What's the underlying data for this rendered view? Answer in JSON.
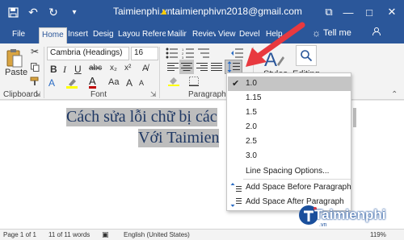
{
  "titlebar": {
    "doc_title": "Taimienphi.vn...",
    "account": "taimienphivn2018@gmail.com",
    "restore_glyph": "⧉",
    "minimize_glyph": "—",
    "maximize_glyph": "□",
    "close_glyph": "✕"
  },
  "tabs": [
    "File",
    "Home",
    "Insert",
    "Desig",
    "Layou",
    "Refere",
    "Mailir",
    "Reviev",
    "View",
    "Devel",
    "Help"
  ],
  "tell_me": "Tell me",
  "ribbon": {
    "paste_label": "Paste",
    "font_name": "Cambria (Headings)",
    "font_size": "16",
    "styles_label": "Styles",
    "editing_label": "Editing",
    "groups": {
      "clipboard": "Clipboard",
      "font": "Font",
      "paragraph": "Paragraph"
    }
  },
  "document": {
    "line1": "Cách sửa lỗi chữ bị các",
    "line2": "Với Taimien"
  },
  "status": {
    "page": "Page 1 of 1",
    "words": "11 of 11 words",
    "language": "English (United States)",
    "zoom": "119%"
  },
  "line_spacing_menu": {
    "options": [
      "1.0",
      "1.15",
      "1.5",
      "2.0",
      "2.5",
      "3.0"
    ],
    "checked_index": 0,
    "more": "Line Spacing Options...",
    "add_before": "Add Space Before Paragraph",
    "add_after": "Add Space After Paragraph"
  },
  "watermark": {
    "text": "Taimienphi",
    "suffix": ".vn"
  },
  "colors": {
    "word_blue": "#2b579a",
    "arrow_red": "#e8393f",
    "heading_text": "#1f3864",
    "selection": "#bdbdbd"
  }
}
